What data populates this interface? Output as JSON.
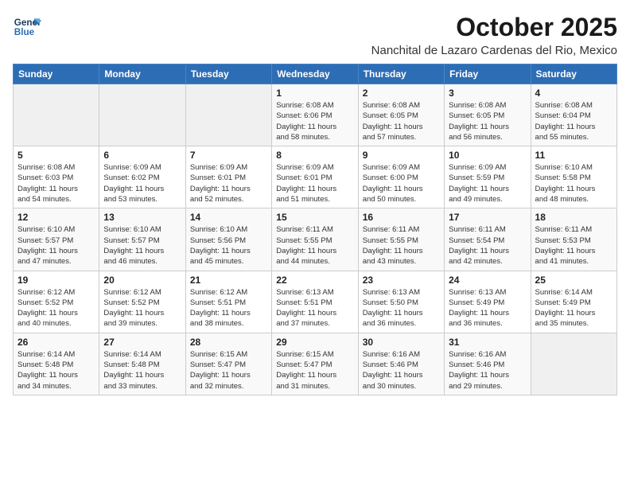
{
  "header": {
    "logo_line1": "General",
    "logo_line2": "Blue",
    "month_title": "October 2025",
    "location": "Nanchital de Lazaro Cardenas del Rio, Mexico"
  },
  "weekdays": [
    "Sunday",
    "Monday",
    "Tuesday",
    "Wednesday",
    "Thursday",
    "Friday",
    "Saturday"
  ],
  "weeks": [
    [
      {
        "day": "",
        "info": ""
      },
      {
        "day": "",
        "info": ""
      },
      {
        "day": "",
        "info": ""
      },
      {
        "day": "1",
        "info": "Sunrise: 6:08 AM\nSunset: 6:06 PM\nDaylight: 11 hours\nand 58 minutes."
      },
      {
        "day": "2",
        "info": "Sunrise: 6:08 AM\nSunset: 6:05 PM\nDaylight: 11 hours\nand 57 minutes."
      },
      {
        "day": "3",
        "info": "Sunrise: 6:08 AM\nSunset: 6:05 PM\nDaylight: 11 hours\nand 56 minutes."
      },
      {
        "day": "4",
        "info": "Sunrise: 6:08 AM\nSunset: 6:04 PM\nDaylight: 11 hours\nand 55 minutes."
      }
    ],
    [
      {
        "day": "5",
        "info": "Sunrise: 6:08 AM\nSunset: 6:03 PM\nDaylight: 11 hours\nand 54 minutes."
      },
      {
        "day": "6",
        "info": "Sunrise: 6:09 AM\nSunset: 6:02 PM\nDaylight: 11 hours\nand 53 minutes."
      },
      {
        "day": "7",
        "info": "Sunrise: 6:09 AM\nSunset: 6:01 PM\nDaylight: 11 hours\nand 52 minutes."
      },
      {
        "day": "8",
        "info": "Sunrise: 6:09 AM\nSunset: 6:01 PM\nDaylight: 11 hours\nand 51 minutes."
      },
      {
        "day": "9",
        "info": "Sunrise: 6:09 AM\nSunset: 6:00 PM\nDaylight: 11 hours\nand 50 minutes."
      },
      {
        "day": "10",
        "info": "Sunrise: 6:09 AM\nSunset: 5:59 PM\nDaylight: 11 hours\nand 49 minutes."
      },
      {
        "day": "11",
        "info": "Sunrise: 6:10 AM\nSunset: 5:58 PM\nDaylight: 11 hours\nand 48 minutes."
      }
    ],
    [
      {
        "day": "12",
        "info": "Sunrise: 6:10 AM\nSunset: 5:57 PM\nDaylight: 11 hours\nand 47 minutes."
      },
      {
        "day": "13",
        "info": "Sunrise: 6:10 AM\nSunset: 5:57 PM\nDaylight: 11 hours\nand 46 minutes."
      },
      {
        "day": "14",
        "info": "Sunrise: 6:10 AM\nSunset: 5:56 PM\nDaylight: 11 hours\nand 45 minutes."
      },
      {
        "day": "15",
        "info": "Sunrise: 6:11 AM\nSunset: 5:55 PM\nDaylight: 11 hours\nand 44 minutes."
      },
      {
        "day": "16",
        "info": "Sunrise: 6:11 AM\nSunset: 5:55 PM\nDaylight: 11 hours\nand 43 minutes."
      },
      {
        "day": "17",
        "info": "Sunrise: 6:11 AM\nSunset: 5:54 PM\nDaylight: 11 hours\nand 42 minutes."
      },
      {
        "day": "18",
        "info": "Sunrise: 6:11 AM\nSunset: 5:53 PM\nDaylight: 11 hours\nand 41 minutes."
      }
    ],
    [
      {
        "day": "19",
        "info": "Sunrise: 6:12 AM\nSunset: 5:52 PM\nDaylight: 11 hours\nand 40 minutes."
      },
      {
        "day": "20",
        "info": "Sunrise: 6:12 AM\nSunset: 5:52 PM\nDaylight: 11 hours\nand 39 minutes."
      },
      {
        "day": "21",
        "info": "Sunrise: 6:12 AM\nSunset: 5:51 PM\nDaylight: 11 hours\nand 38 minutes."
      },
      {
        "day": "22",
        "info": "Sunrise: 6:13 AM\nSunset: 5:51 PM\nDaylight: 11 hours\nand 37 minutes."
      },
      {
        "day": "23",
        "info": "Sunrise: 6:13 AM\nSunset: 5:50 PM\nDaylight: 11 hours\nand 36 minutes."
      },
      {
        "day": "24",
        "info": "Sunrise: 6:13 AM\nSunset: 5:49 PM\nDaylight: 11 hours\nand 36 minutes."
      },
      {
        "day": "25",
        "info": "Sunrise: 6:14 AM\nSunset: 5:49 PM\nDaylight: 11 hours\nand 35 minutes."
      }
    ],
    [
      {
        "day": "26",
        "info": "Sunrise: 6:14 AM\nSunset: 5:48 PM\nDaylight: 11 hours\nand 34 minutes."
      },
      {
        "day": "27",
        "info": "Sunrise: 6:14 AM\nSunset: 5:48 PM\nDaylight: 11 hours\nand 33 minutes."
      },
      {
        "day": "28",
        "info": "Sunrise: 6:15 AM\nSunset: 5:47 PM\nDaylight: 11 hours\nand 32 minutes."
      },
      {
        "day": "29",
        "info": "Sunrise: 6:15 AM\nSunset: 5:47 PM\nDaylight: 11 hours\nand 31 minutes."
      },
      {
        "day": "30",
        "info": "Sunrise: 6:16 AM\nSunset: 5:46 PM\nDaylight: 11 hours\nand 30 minutes."
      },
      {
        "day": "31",
        "info": "Sunrise: 6:16 AM\nSunset: 5:46 PM\nDaylight: 11 hours\nand 29 minutes."
      },
      {
        "day": "",
        "info": ""
      }
    ]
  ]
}
